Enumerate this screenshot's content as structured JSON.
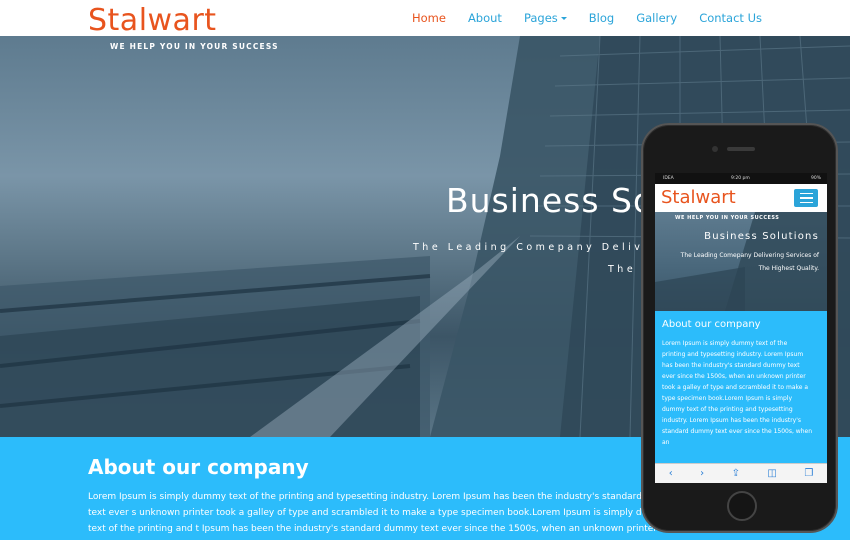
{
  "site": {
    "logo": "Stalwart",
    "tagline": "WE HELP YOU IN YOUR SUCCESS"
  },
  "nav": {
    "items": [
      {
        "label": "Home",
        "active": true
      },
      {
        "label": "About",
        "active": false
      },
      {
        "label": "Pages",
        "active": false,
        "dropdown": true
      },
      {
        "label": "Blog",
        "active": false
      },
      {
        "label": "Gallery",
        "active": false
      },
      {
        "label": "Contact Us",
        "active": false
      }
    ]
  },
  "hero": {
    "title": "Business So",
    "subtitle_line1": "The Leading Comepany Delive",
    "subtitle_line2": "The"
  },
  "about": {
    "title": "About our company",
    "text": "Lorem Ipsum is simply dummy text of the printing and typesetting industry. Lorem Ipsum has been the industry's standard dummy text ever s unknown printer took a galley of type and scrambled it to make a type specimen book.Lorem Ipsum is simply dummy text of the printing and t Ipsum has been the industry's standard dummy text ever since the 1500s, when an unknown printer took.."
  },
  "phone": {
    "status": {
      "carrier": "IDEA",
      "time": "9:20 pm",
      "battery": "90%"
    },
    "logo": "Stalwart",
    "tagline": "WE HELP YOU IN YOUR SUCCESS",
    "hero_title": "Business Solutions",
    "hero_sub": "The Leading Comepany Delivering Services of The Highest Quality.",
    "about_title": "About our company",
    "about_text": "Lorem Ipsum is simply dummy text of the printing and typesetting industry. Lorem Ipsum has been the industry's standard dummy text ever since the 1500s, when an unknown printer took a galley of type and scrambled it to make a type specimen book.Lorem Ipsum is simply dummy text of the printing and typesetting industry. Lorem Ipsum has been the industry's standard dummy text ever since the 1500s, when an"
  },
  "colors": {
    "brand_orange": "#e8541e",
    "nav_blue": "#2ba4d9",
    "about_bg": "#2cbcfb"
  }
}
